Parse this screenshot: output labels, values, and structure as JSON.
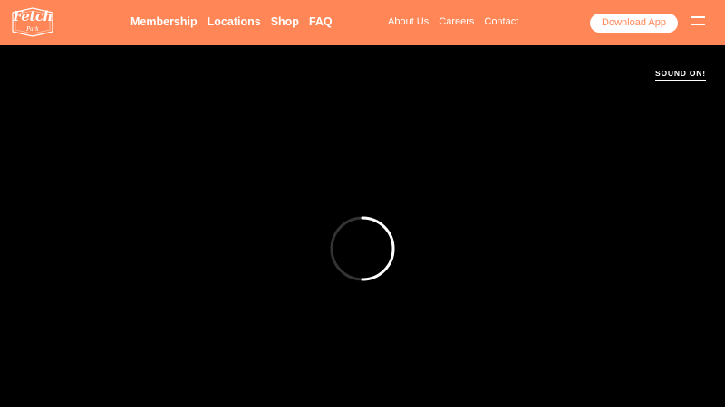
{
  "header": {
    "logo": {
      "title": "Fetch",
      "subtitle": "Park"
    },
    "main_nav": [
      {
        "label": "Membership"
      },
      {
        "label": "Locations"
      },
      {
        "label": "Shop"
      },
      {
        "label": "FAQ"
      }
    ],
    "secondary_nav": [
      {
        "label": "About Us"
      },
      {
        "label": "Careers"
      },
      {
        "label": "Contact"
      }
    ],
    "download_label": "Download App",
    "menu_icon": "hamburger-menu-icon"
  },
  "video": {
    "sound_label": "SOUND ON!",
    "loading_icon": "loading-spinner-icon"
  },
  "colors": {
    "brand": "#ff8656",
    "background": "#000000",
    "text": "#ffffff"
  }
}
